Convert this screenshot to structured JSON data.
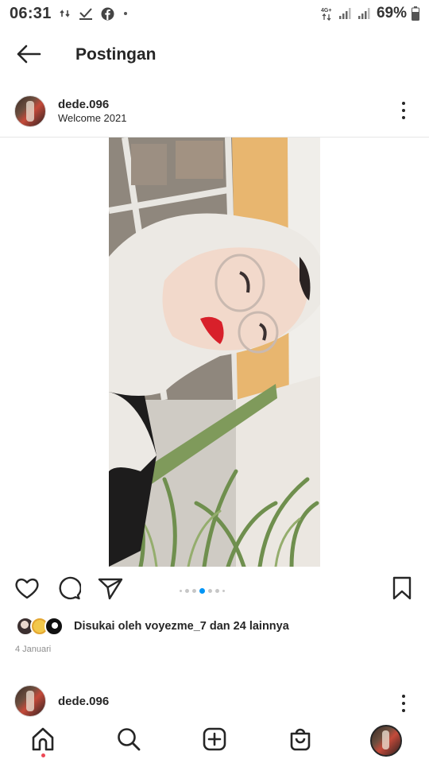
{
  "status_bar": {
    "time": "06:31",
    "network_label": "4G+",
    "battery_percent": "69%"
  },
  "header": {
    "title": "Postingan"
  },
  "post": {
    "username": "dede.096",
    "location": "Welcome 2021",
    "carousel": {
      "total": 7,
      "active_index": 3
    },
    "likes_text": "Disukai oleh voyezme_7 dan 24 lainnya",
    "date": "4 Januari"
  },
  "next_post": {
    "username": "dede.096"
  },
  "icons": {
    "back": "arrow-left-icon",
    "more": "more-vertical-icon",
    "like": "heart-icon",
    "comment": "comment-icon",
    "share": "send-icon",
    "save": "bookmark-icon",
    "home": "home-icon",
    "search": "search-icon",
    "create": "plus-square-icon",
    "shop": "shopping-bag-icon"
  },
  "colors": {
    "text": "#262626",
    "muted": "#8e8e8e",
    "carousel_active": "#0095f6",
    "notification": "#ed4956"
  }
}
